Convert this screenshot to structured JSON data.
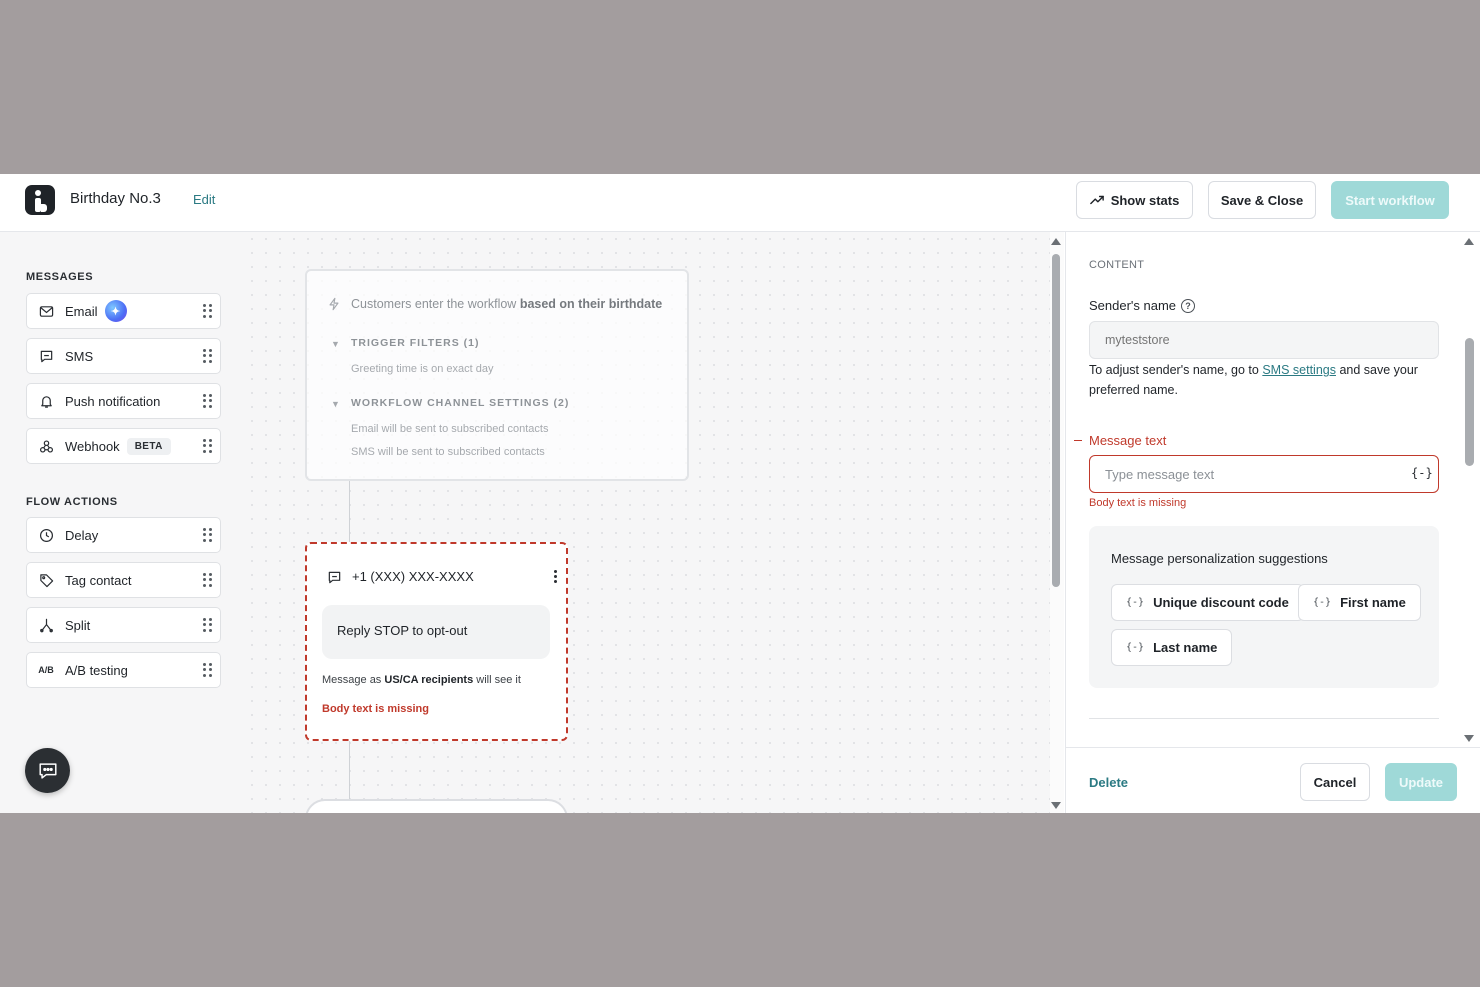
{
  "header": {
    "workflow_name": "Birthday No.3",
    "edit_label": "Edit",
    "show_stats_label": "Show stats",
    "save_close_label": "Save & Close",
    "start_workflow_label": "Start workflow"
  },
  "palette": {
    "messages_label": "MESSAGES",
    "messages": [
      {
        "label": "Email",
        "icon": "mail-icon"
      },
      {
        "label": "SMS",
        "icon": "chat-bubble-icon"
      },
      {
        "label": "Push notification",
        "icon": "bell-icon"
      },
      {
        "label": "Webhook",
        "icon": "webhook-icon",
        "badge": "BETA"
      }
    ],
    "flow_actions_label": "FLOW ACTIONS",
    "flow_actions": [
      {
        "label": "Delay",
        "icon": "clock-icon"
      },
      {
        "label": "Tag contact",
        "icon": "tag-icon"
      },
      {
        "label": "Split",
        "icon": "split-icon"
      },
      {
        "label": "A/B testing",
        "icon": "ab-icon",
        "icon_text": "A/B"
      }
    ]
  },
  "canvas": {
    "trigger": {
      "title_prefix": "Customers enter the workflow ",
      "title_bold": "based on their birthdate",
      "filters_label": "TRIGGER FILTERS (1)",
      "filters": [
        "Greeting time is on exact day"
      ],
      "channel_label": "WORKFLOW CHANNEL SETTINGS (2)",
      "channel_lines": [
        "Email will be sent to subscribed contacts",
        "SMS will be sent to subscribed contacts"
      ]
    },
    "sms_node": {
      "phone": "+1 (XXX) XXX-XXXX",
      "bubble_text": "Reply STOP to opt-out",
      "note_prefix": "Message as ",
      "note_bold": "US/CA recipients",
      "note_suffix": " will see it",
      "error": "Body text is missing"
    }
  },
  "panel": {
    "section_label": "CONTENT",
    "sender_label": "Sender's name",
    "sender_placeholder": "myteststore",
    "sender_help_prefix": "To adjust sender's name, go to ",
    "sender_help_link": "SMS settings",
    "sender_help_suffix": " and save your preferred name.",
    "message_label": "Message text",
    "message_placeholder": "Type message text",
    "variable_symbol": "{-}",
    "message_error": "Body text is missing",
    "suggestions_title": "Message personalization suggestions",
    "suggestions": [
      "Unique discount code",
      "First name",
      "Last name"
    ],
    "delete_label": "Delete",
    "cancel_label": "Cancel",
    "update_label": "Update"
  },
  "colors": {
    "accent": "#2b7a83",
    "primary_disabled": "#9fd9d8",
    "error": "#c0392b",
    "backdrop": "#a39d9e"
  }
}
